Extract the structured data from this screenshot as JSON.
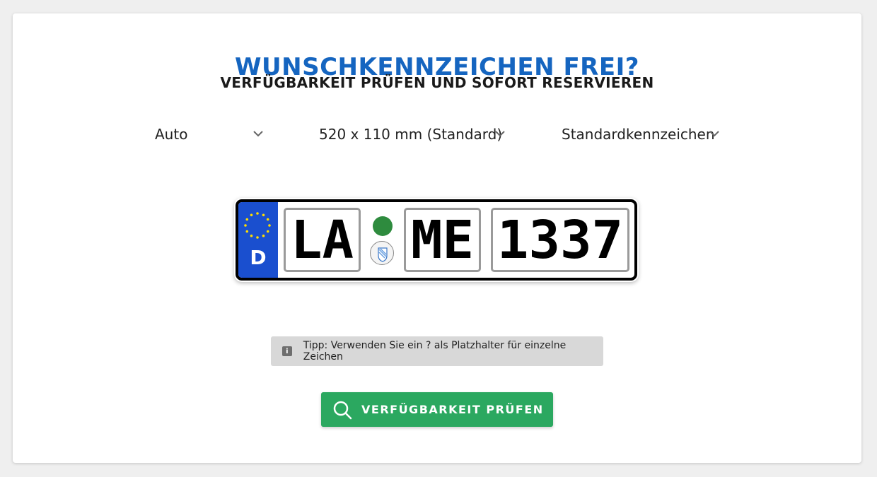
{
  "header": {
    "title": "WUNSCHKENNZEICHEN FREI?",
    "subtitle": "VERFÜGBARKEIT PRÜFEN UND SOFORT RESERVIEREN"
  },
  "selects": {
    "vehicle": "Auto",
    "size": "520 x 110 mm (Standard)",
    "plate_type": "Standardkennzeichen"
  },
  "plate": {
    "country_code": "D",
    "district": "LA",
    "letters": "ME",
    "numbers": "1337",
    "colors": {
      "eu_blue": "#1a4fcf",
      "seal_green": "#2e8b3e"
    }
  },
  "tip": {
    "icon": "info-icon",
    "text": "Tipp: Verwenden Sie ein ? als Platzhalter für einzelne Zeichen"
  },
  "action": {
    "icon": "search-icon",
    "label": "VERFÜGBARKEIT PRÜFEN",
    "color": "#2ba860"
  },
  "theme": {
    "title_color": "#1565c0"
  }
}
